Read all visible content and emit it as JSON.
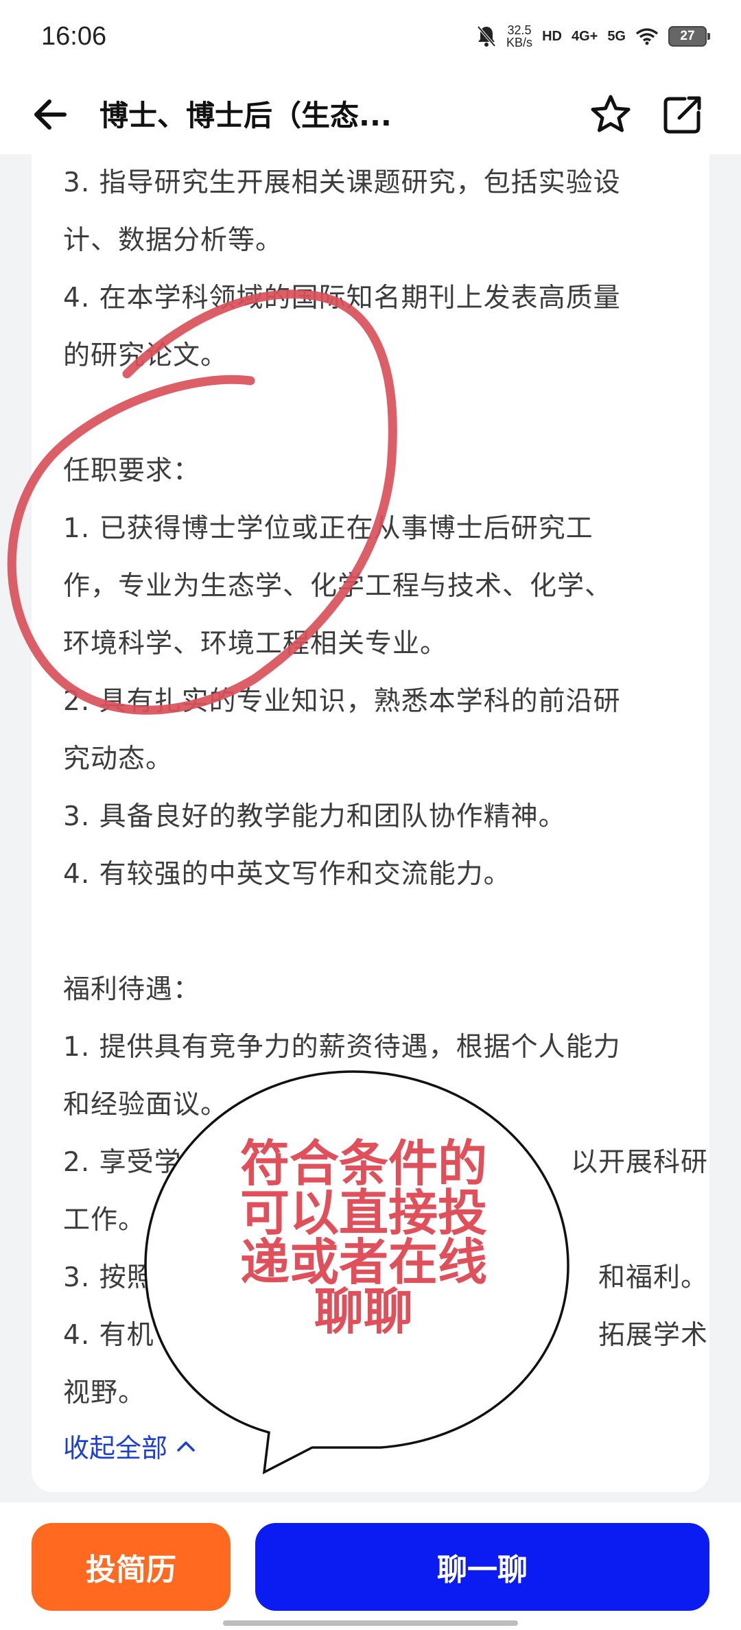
{
  "status": {
    "time": "16:06",
    "net_speed_value": "32.5",
    "net_speed_unit": "KB/s",
    "hd_label": "HD",
    "signal1": "4G+",
    "signal2": "5G",
    "battery": "27"
  },
  "header": {
    "title": "博士、博士后（生态...",
    "back_icon": "back-arrow-icon",
    "star_icon": "star-icon",
    "share_icon": "share-icon"
  },
  "job": {
    "lines": [
      "3. 指导研究生开展相关课题研究，包括实验设",
      "计、数据分析等。",
      "4. 在本学科领域的国际知名期刊上发表高质量",
      "的研究论文。",
      "",
      "任职要求：",
      "1. 已获得博士学位或正在从事博士后研究工",
      "作，专业为生态学、化学工程与技术、化学、",
      "环境科学、环境工程相关专业。",
      "2. 具有扎实的专业知识，熟悉本学科的前沿研",
      "究动态。",
      "3. 具备良好的教学能力和团队协作精神。",
      "4. 有较强的中英文写作和交流能力。",
      "",
      "福利待遇：",
      "1. 提供具有竞争力的薪资待遇，根据个人能力",
      "和经验面议。",
      "2. 享受学",
      "工作。",
      "3. 按照",
      "4. 有机",
      "视野。"
    ],
    "right_fragments": {
      "17": "以开展科研",
      "19": "和福利。",
      "20": "拓展学术"
    },
    "collapse_label": "收起全部"
  },
  "annotation": {
    "bubble_lines": [
      "符合条件的",
      "可以直接投",
      "递或者在线",
      "聊聊"
    ],
    "circle_color": "#d9505a",
    "bubble_text_color": "#e0505a"
  },
  "actions": {
    "resume_label": "投简历",
    "chat_label": "聊一聊",
    "resume_color": "#ff6a20",
    "chat_color": "#0a1cf2"
  }
}
